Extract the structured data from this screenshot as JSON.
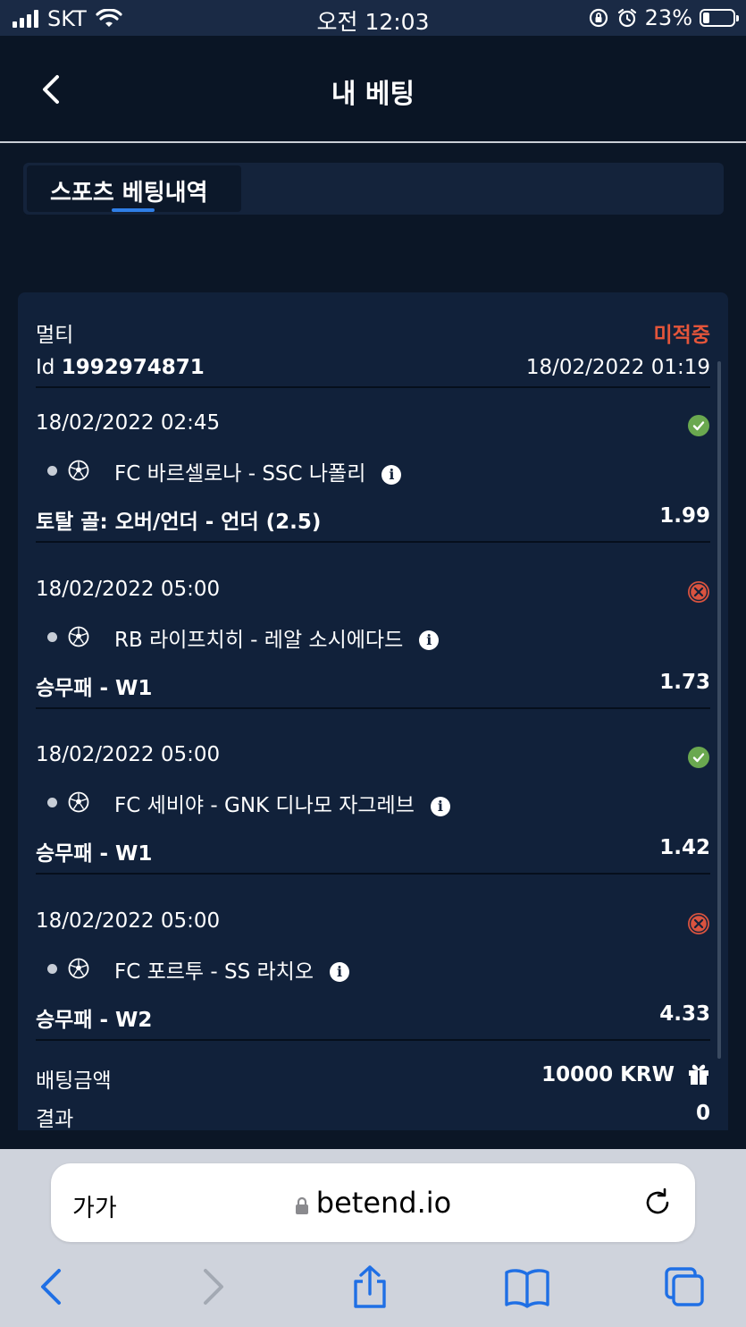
{
  "status_bar": {
    "carrier": "SKT",
    "time": "오전 12:03",
    "battery": "23%",
    "battery_level": 0.23
  },
  "header": {
    "title": "내 베팅"
  },
  "tabs": [
    {
      "label": "스포츠 베팅내역",
      "active": true
    }
  ],
  "bet": {
    "type": "멀티",
    "status": "미적중",
    "id_label": "Id",
    "id": "1992974871",
    "placed_at": "18/02/2022 01:19",
    "selections": [
      {
        "date": "18/02/2022 02:45",
        "match": "FC 바르셀로나 - SSC 나폴리",
        "market": "토탈 골: 오버/언더 - 언더 (2.5)",
        "odds": "1.99",
        "result": "won"
      },
      {
        "date": "18/02/2022 05:00",
        "match": "RB 라이프치히 - 레알 소시에다드",
        "market": "승무패 - W1",
        "odds": "1.73",
        "result": "lost"
      },
      {
        "date": "18/02/2022 05:00",
        "match": "FC 세비야 - GNK 디나모 자그레브",
        "market": "승무패 - W1",
        "odds": "1.42",
        "result": "won"
      },
      {
        "date": "18/02/2022 05:00",
        "match": "FC 포르투 - SS 라치오",
        "market": "승무패 - W2",
        "odds": "4.33",
        "result": "lost"
      }
    ],
    "stake_label": "배팅금액",
    "stake": "10000 KRW",
    "result_label": "결과",
    "result": "0"
  },
  "browser": {
    "text_size": "가가",
    "url": "betend.io"
  },
  "colors": {
    "accent": "#2f7ee6",
    "lost": "#d9533f",
    "won": "#6aa84f",
    "status_lost": "#e4553a"
  }
}
